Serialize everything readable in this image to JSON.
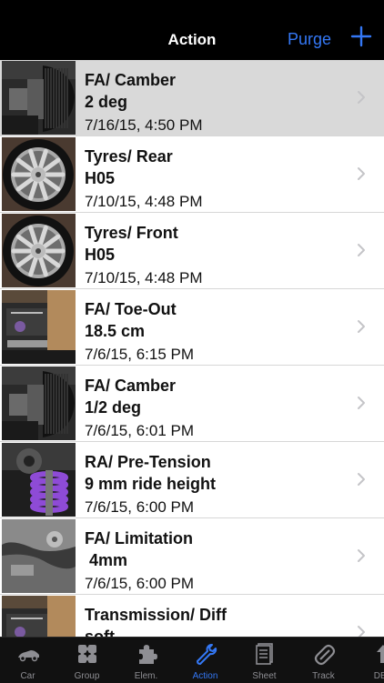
{
  "nav": {
    "title": "Action",
    "purge_label": "Purge"
  },
  "rows": [
    {
      "title": "FA/ Camber",
      "value": "2 deg",
      "timestamp": "7/16/15, 4:50 PM",
      "selected": true,
      "thumb": "tire-side"
    },
    {
      "title": "Tyres/ Rear",
      "value": "H05",
      "timestamp": "7/10/15, 4:48 PM",
      "thumb": "wheel"
    },
    {
      "title": "Tyres/ Front",
      "value": "H05",
      "timestamp": "7/10/15, 4:48 PM",
      "thumb": "wheel"
    },
    {
      "title": "FA/ Toe-Out",
      "value": "18.5 cm",
      "timestamp": "7/6/15, 6:15 PM",
      "thumb": "chassis"
    },
    {
      "title": "FA/ Camber",
      "value": "1/2 deg",
      "timestamp": "7/6/15, 6:01 PM",
      "thumb": "tire-side"
    },
    {
      "title": "RA/ Pre-Tension",
      "value": "9 mm ride height",
      "timestamp": "7/6/15, 6:00 PM",
      "thumb": "spring"
    },
    {
      "title": "FA/ Limitation",
      "value": " 4mm",
      "timestamp": "7/6/15, 6:00 PM",
      "thumb": "metal"
    },
    {
      "title": "Transmission/ Diff",
      "value": "soft",
      "timestamp": "",
      "thumb": "chassis"
    }
  ],
  "tabs": [
    {
      "label": "Car",
      "icon": "car-icon"
    },
    {
      "label": "Group",
      "icon": "group-icon"
    },
    {
      "label": "Elem.",
      "icon": "puzzle-icon"
    },
    {
      "label": "Action",
      "icon": "wrench-icon",
      "active": true
    },
    {
      "label": "Sheet",
      "icon": "sheet-icon"
    },
    {
      "label": "Track",
      "icon": "track-icon"
    },
    {
      "label": "DBa",
      "icon": "upload-icon"
    }
  ],
  "colors": {
    "accent": "#3478f6",
    "selected_row": "#d9d9d9"
  }
}
